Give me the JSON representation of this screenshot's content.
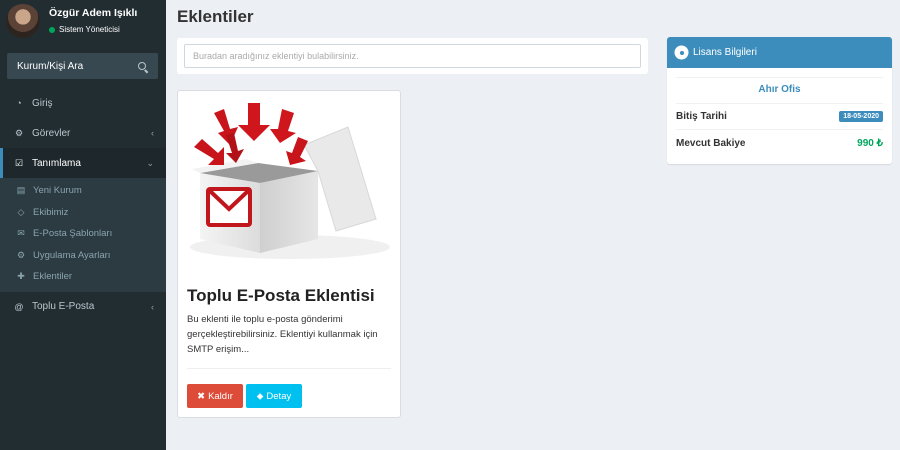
{
  "user": {
    "name": "Özgür Adem Işıklı",
    "role": "Sistem Yöneticisi"
  },
  "sidebar_search": {
    "placeholder": "Kurum/Kişi Ara"
  },
  "menu": {
    "items": [
      {
        "label": "Giriş",
        "icon": "dashboard-icon"
      },
      {
        "label": "Görevler",
        "icon": "cogs-icon"
      },
      {
        "label": "Tanımlama",
        "icon": "checkbox-icon"
      },
      {
        "label": "Toplu E-Posta",
        "icon": "at-icon"
      }
    ],
    "submenu": [
      {
        "label": "Yeni Kurum",
        "icon": "document-icon"
      },
      {
        "label": "Ekibimiz",
        "icon": "diamond-icon"
      },
      {
        "label": "E-Posta Şablonları",
        "icon": "envelope-icon"
      },
      {
        "label": "Uygulama Ayarları",
        "icon": "cogs-icon"
      },
      {
        "label": "Eklentiler",
        "icon": "puzzle-icon"
      }
    ]
  },
  "page": {
    "title": "Eklentiler",
    "search_placeholder": "Buradan aradığınız eklentiyi bulabilirsiniz."
  },
  "extension": {
    "title": "Toplu E-Posta Eklentisi",
    "description": "Bu eklenti ile toplu e-posta gönderimi gerçekleştirebilirsiniz. Eklentiyi kullanmak için SMTP erişim...",
    "remove_label": "Kaldır",
    "detail_label": "Detay"
  },
  "license": {
    "header": "Lisans Bilgileri",
    "company": "Ahır Ofis",
    "end_date_label": "Bitiş Tarihi",
    "end_date": "18-05-2020",
    "balance_label": "Mevcut Bakiye",
    "balance": "990 ₺"
  },
  "colors": {
    "sidebar": "#222d32",
    "primary": "#3c8dbc",
    "danger": "#dd4b39",
    "info": "#00c0ef",
    "success": "#00a65a"
  }
}
